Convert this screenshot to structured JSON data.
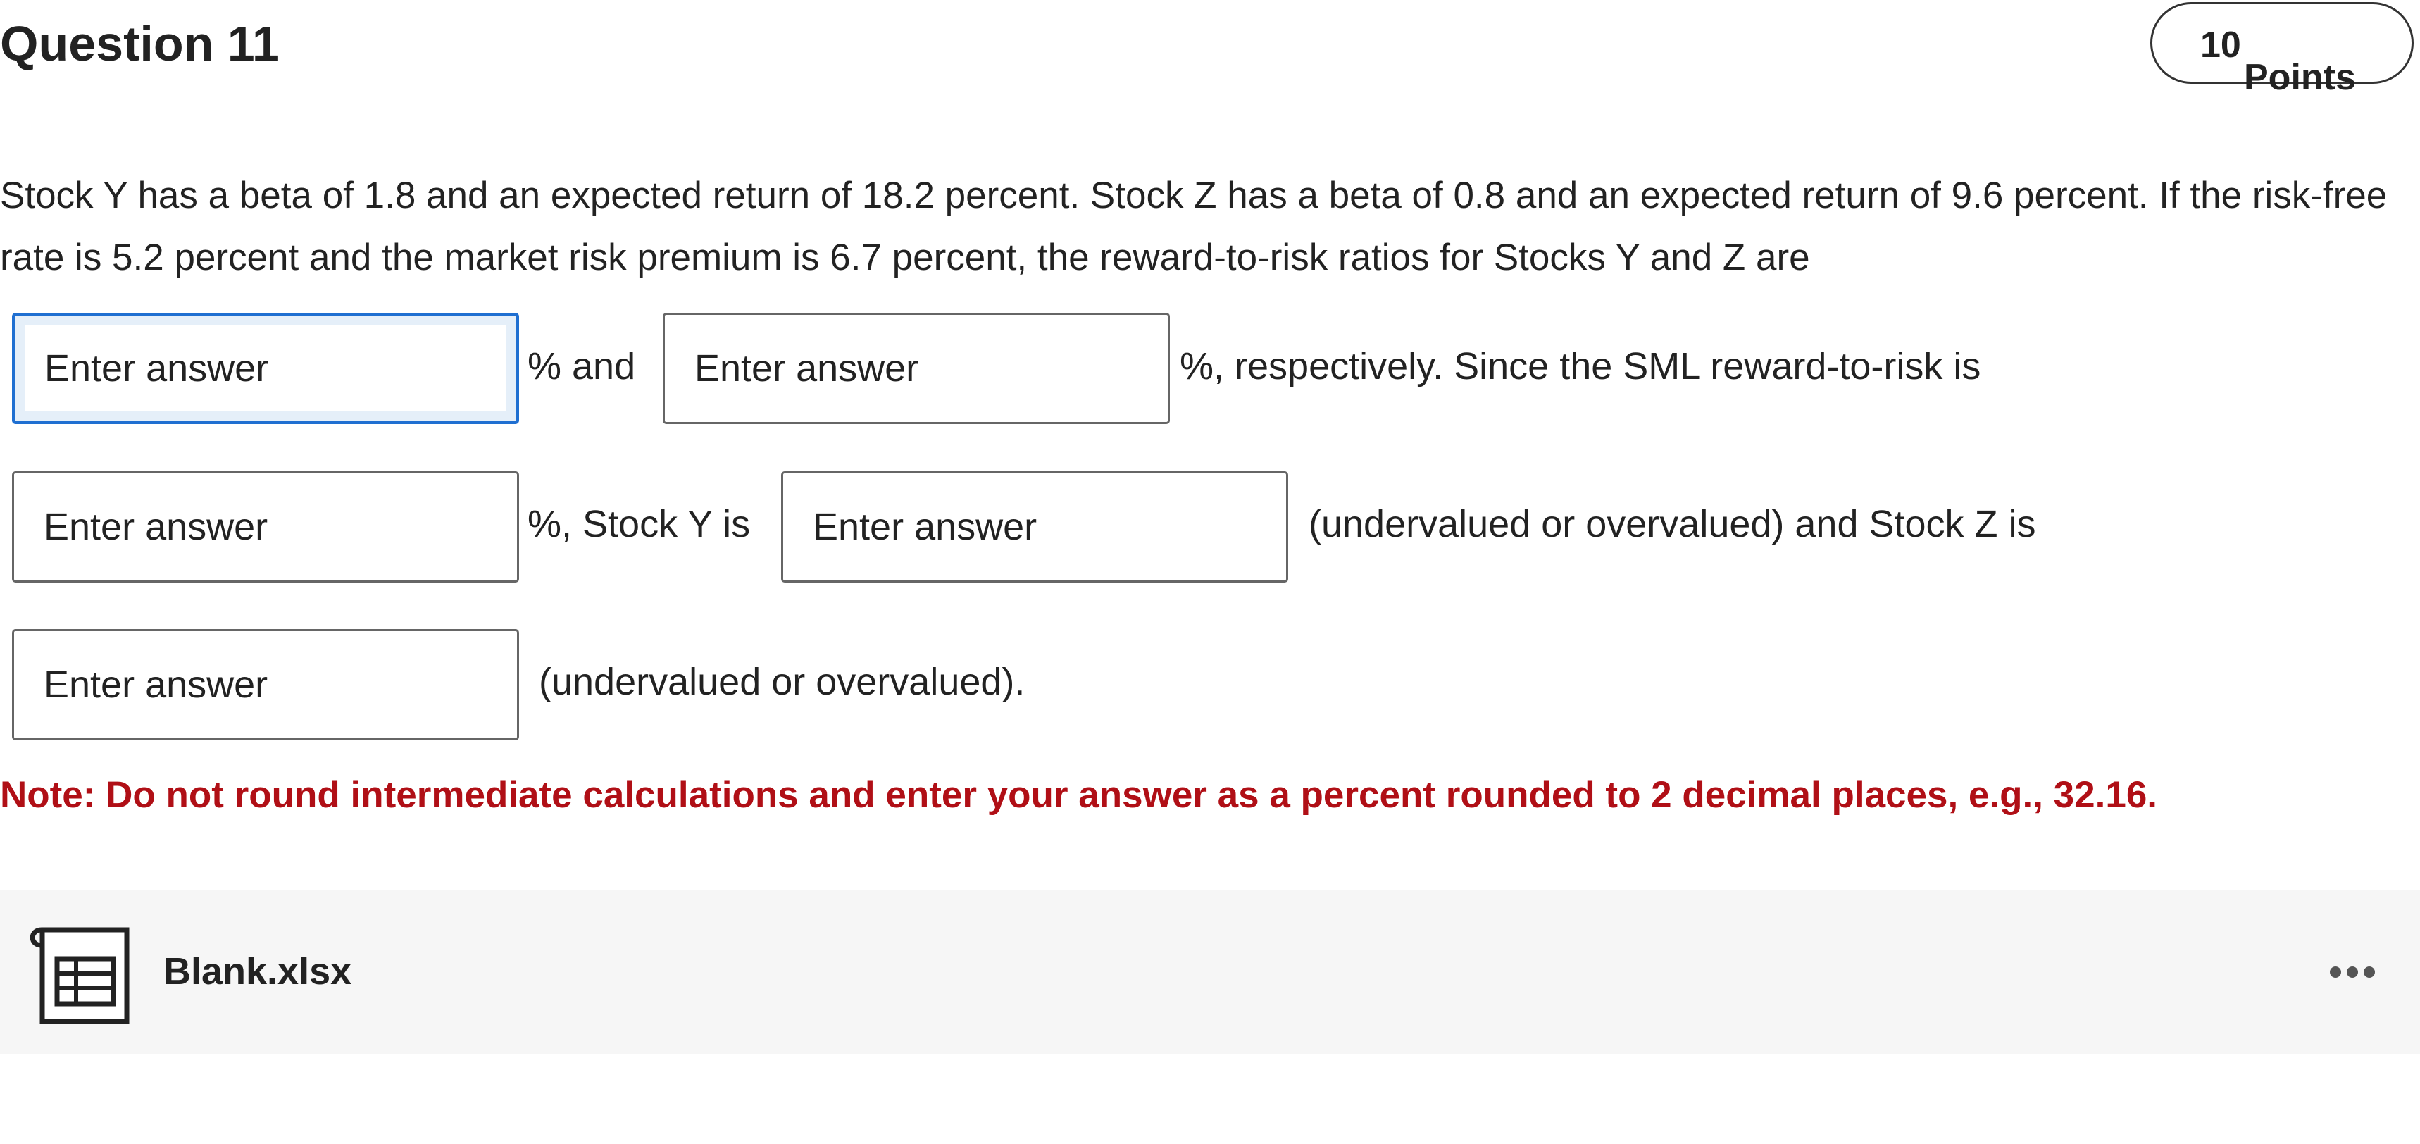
{
  "question": {
    "title": "Question 11",
    "points_value": "10",
    "points_label": "Points"
  },
  "prompt": {
    "text": "Stock Y has a beta of 1.8 and an expected return of 18.2 percent. Stock Z has a beta of 0.8 and an expected return of 9.6 percent. If the risk-free rate is 5.2 percent and the market risk premium is 6.7 percent, the reward-to-risk ratios for Stocks Y and Z are"
  },
  "answers": {
    "placeholder": "Enter answer",
    "text_after_1": "% and",
    "text_after_2": "%, respectively. Since the SML reward-to-risk is",
    "text_after_3": "%, Stock Y is",
    "text_after_4": "(undervalued or overvalued) and Stock Z is",
    "text_after_5": "(undervalued or overvalued)."
  },
  "note": {
    "text": "Note: Do not round intermediate calculations and enter your answer as a percent rounded to 2 decimal places, e.g., 32.16."
  },
  "attachment": {
    "file_name": "Blank.xlsx",
    "icon": "spreadsheet-file-icon",
    "menu_icon": "more-options-icon"
  },
  "colors": {
    "note": "#b00f16",
    "focus_border": "#1f6fd1",
    "attachment_background": "#f6f6f6"
  }
}
